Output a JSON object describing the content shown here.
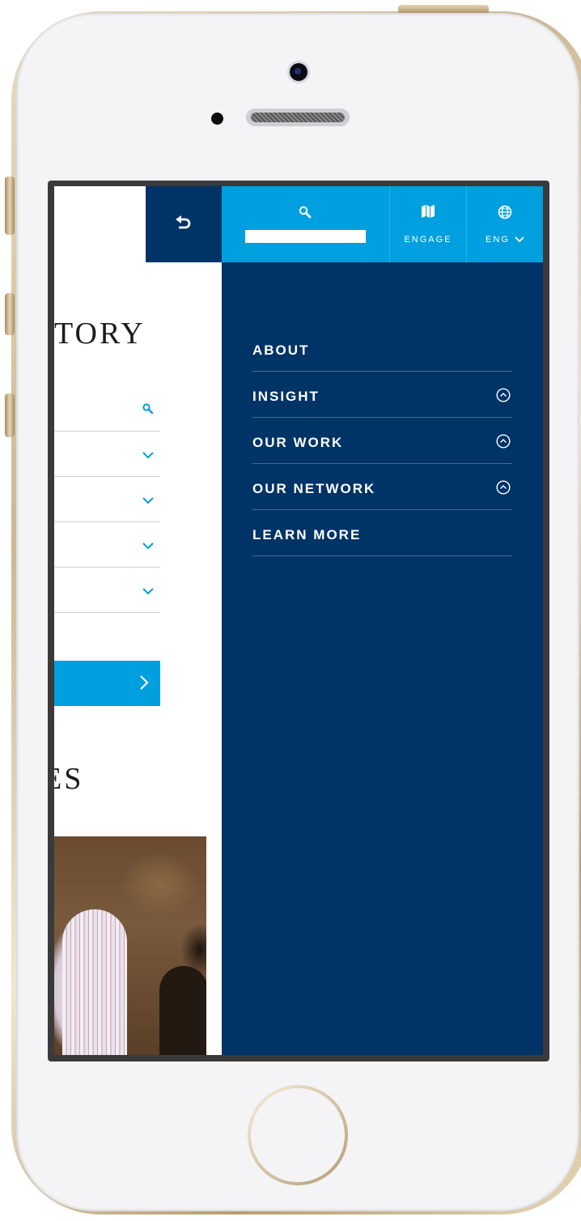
{
  "page": {
    "title": "TORY",
    "section_title": "ES"
  },
  "topbar": {
    "search_placeholder": "",
    "engage_label": "ENGAGE",
    "lang_label": "ENG"
  },
  "menu": {
    "items": [
      {
        "label": "ABOUT",
        "expandable": false
      },
      {
        "label": "INSIGHT",
        "expandable": true
      },
      {
        "label": "OUR WORK",
        "expandable": true
      },
      {
        "label": "OUR NETWORK",
        "expandable": true
      },
      {
        "label": "LEARN MORE",
        "expandable": false
      }
    ]
  },
  "icons": {
    "back": "back-arrow-icon",
    "search": "search-icon",
    "engage": "map-icon",
    "language": "globe-icon",
    "expand": "chevron-up-circle-icon"
  },
  "colors": {
    "accent": "#009fdf",
    "navy": "#003366"
  }
}
